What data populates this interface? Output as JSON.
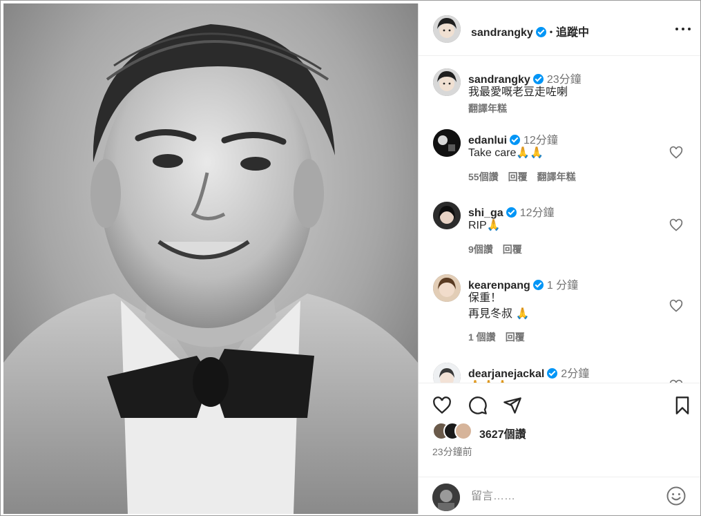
{
  "header": {
    "username": "sandrangky",
    "follow_label": "追蹤中",
    "more_icon": "more-options-icon"
  },
  "comments": [
    {
      "user": "sandrangky",
      "time": "23分鐘",
      "lines": [
        "我最愛嘅老豆走咗喇"
      ],
      "translate": "翻譯年糕"
    },
    {
      "user": "edanlui",
      "time": "12分鐘",
      "lines": [
        "Take care🙏🙏"
      ],
      "likes": "55個讚",
      "reply": "回覆",
      "translate": "翻譯年糕"
    },
    {
      "user": "shi_ga",
      "time": "12分鐘",
      "lines": [
        "RIP🙏"
      ],
      "likes": "9個讚",
      "reply": "回覆"
    },
    {
      "user": "kearenpang",
      "time": "1 分鐘",
      "lines": [
        "保重！",
        "再見冬叔 🙏"
      ],
      "likes": "1 個讚",
      "reply": "回覆"
    },
    {
      "user": "dearjanejackal",
      "time": "2分鐘",
      "lines": [
        "🙏🙏🙏"
      ]
    }
  ],
  "actions": {
    "likes_count": "3627個讚",
    "posted_time": "23分鐘前"
  },
  "comment_box": {
    "placeholder": "留言……"
  },
  "colors": {
    "verified": "#0095f6",
    "text": "#262626",
    "secondary": "#737373",
    "divider": "#efefef"
  }
}
